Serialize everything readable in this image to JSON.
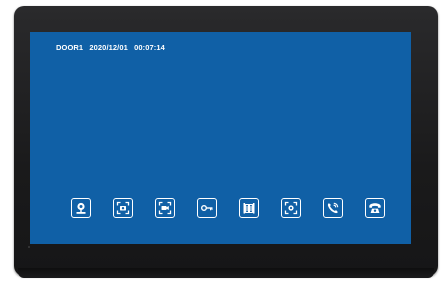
{
  "screen": {
    "background": "#1060a6",
    "status": {
      "door": "DOOR1",
      "date": "2020/12/01",
      "time": "00:07:14"
    }
  },
  "toolbar": {
    "buttons": [
      {
        "id": "monitor",
        "icon": "camera-monitor-icon"
      },
      {
        "id": "capture-photo",
        "icon": "photo-capture-icon"
      },
      {
        "id": "record-video",
        "icon": "video-record-icon"
      },
      {
        "id": "unlock",
        "icon": "key-unlock-icon"
      },
      {
        "id": "gate",
        "icon": "gate-icon"
      },
      {
        "id": "camera-switch",
        "icon": "camera-switch-icon"
      },
      {
        "id": "intercom-call",
        "icon": "intercom-phone-icon"
      },
      {
        "id": "hang-up",
        "icon": "hang-up-phone-icon"
      }
    ]
  }
}
